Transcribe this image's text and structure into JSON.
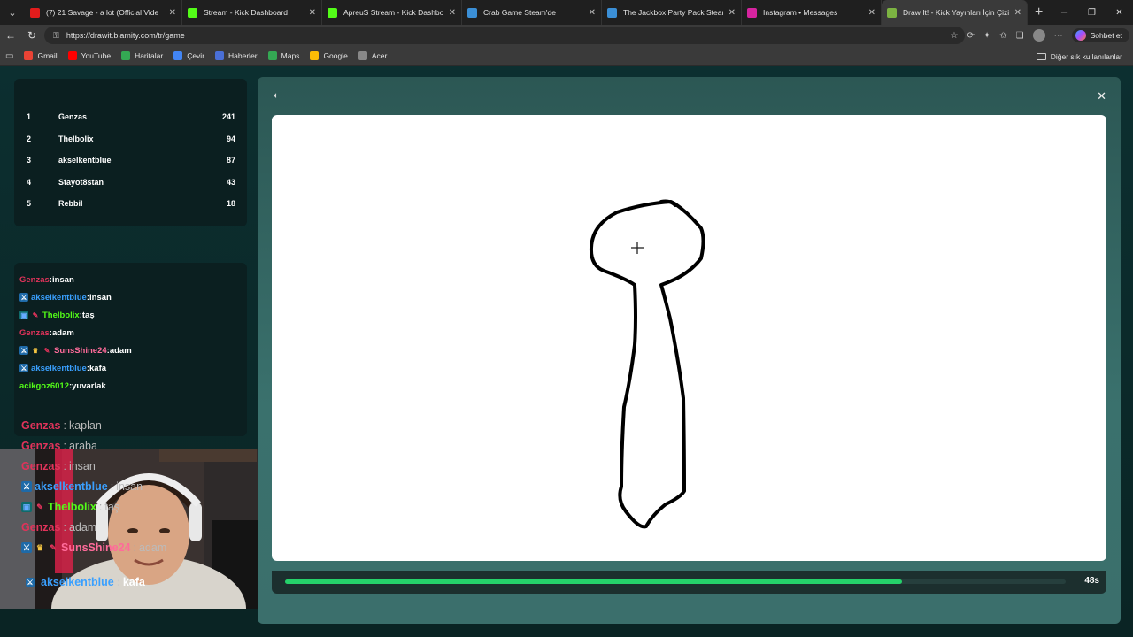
{
  "tabs": [
    {
      "title": "(7) 21 Savage - a lot (Official Vide",
      "color": "#e21c1c"
    },
    {
      "title": "Stream - Kick Dashboard",
      "color": "#53fc18"
    },
    {
      "title": "ApreuS Stream - Kick Dashboard",
      "color": "#53fc18"
    },
    {
      "title": "Crab Game Steam'de",
      "color": "#3b8fd6"
    },
    {
      "title": "The Jackbox Party Pack Steam'de",
      "color": "#3b8fd6"
    },
    {
      "title": "Instagram • Messages",
      "color": "#d6249f"
    },
    {
      "title": "Draw It! - Kick Yayınları İçin Çizim",
      "color": "#7cb342"
    }
  ],
  "url": "https://drawit.blamity.com/tr/game",
  "copilot_label": "Sohbet et",
  "bookmarks": [
    {
      "label": "Gmail",
      "color": "#ea4335"
    },
    {
      "label": "YouTube",
      "color": "#ff0000"
    },
    {
      "label": "Haritalar",
      "color": "#34a853"
    },
    {
      "label": "Çevir",
      "color": "#4285f4"
    },
    {
      "label": "Haberler",
      "color": "#4a6fd6"
    },
    {
      "label": "Maps",
      "color": "#34a853"
    },
    {
      "label": "Google",
      "color": "#fbbc05"
    },
    {
      "label": "Acer",
      "color": "#888888"
    }
  ],
  "other_bookmarks": "Diğer sık kullanılanlar",
  "leaderboard": [
    {
      "rank": "1",
      "name": "Genzas",
      "score": "241"
    },
    {
      "rank": "2",
      "name": "Thelbolix",
      "score": "94"
    },
    {
      "rank": "3",
      "name": "akselkentblue",
      "score": "87"
    },
    {
      "rank": "4",
      "name": "Stayot8stan",
      "score": "43"
    },
    {
      "rank": "5",
      "name": "Rebbil",
      "score": "18"
    }
  ],
  "chat": [
    {
      "user": "Genzas",
      "color": "#e0335a",
      "text": ":insan"
    },
    {
      "user": "akselkentblue",
      "color": "#3aa0ff",
      "text": ":insan"
    },
    {
      "user": "Thelbolix",
      "color": "#53fc18",
      "text": ":taş"
    },
    {
      "user": "Genzas",
      "color": "#e0335a",
      "text": ":adam"
    },
    {
      "user": "SunsShine24",
      "color": "#ff6b9a",
      "text": ":adam"
    },
    {
      "user": "akselkentblue",
      "color": "#3aa0ff",
      "text": ":kafa"
    },
    {
      "user": "acikgoz6012",
      "color": "#53fc18",
      "text": ":yuvarlak"
    }
  ],
  "guesses": [
    {
      "user": "Genzas",
      "color": "#e0335a",
      "sep": ":",
      "word": "kaplan"
    },
    {
      "user": "Genzas",
      "color": "#e0335a",
      "sep": ":",
      "word": "araba"
    },
    {
      "user": "Genzas",
      "color": "#e0335a",
      "sep": ":",
      "word": "insan"
    },
    {
      "user": "akselkentblue",
      "color": "#3aa0ff",
      "sep": ":",
      "word": "insan"
    },
    {
      "user": "Thelbolix",
      "color": "#53fc18",
      "sep": ":",
      "word": "taş"
    },
    {
      "user": "Genzas",
      "color": "#e0335a",
      "sep": ":",
      "word": "adam"
    },
    {
      "user": "SunsShine24",
      "color": "#ff6b9a",
      "sep": ":",
      "word": "adam"
    }
  ],
  "last_guess": {
    "user": "akselkentblue",
    "color": "#3aa0ff",
    "sep": ":",
    "word": "kafa"
  },
  "timer": {
    "label": "48s",
    "fraction": 0.79
  }
}
